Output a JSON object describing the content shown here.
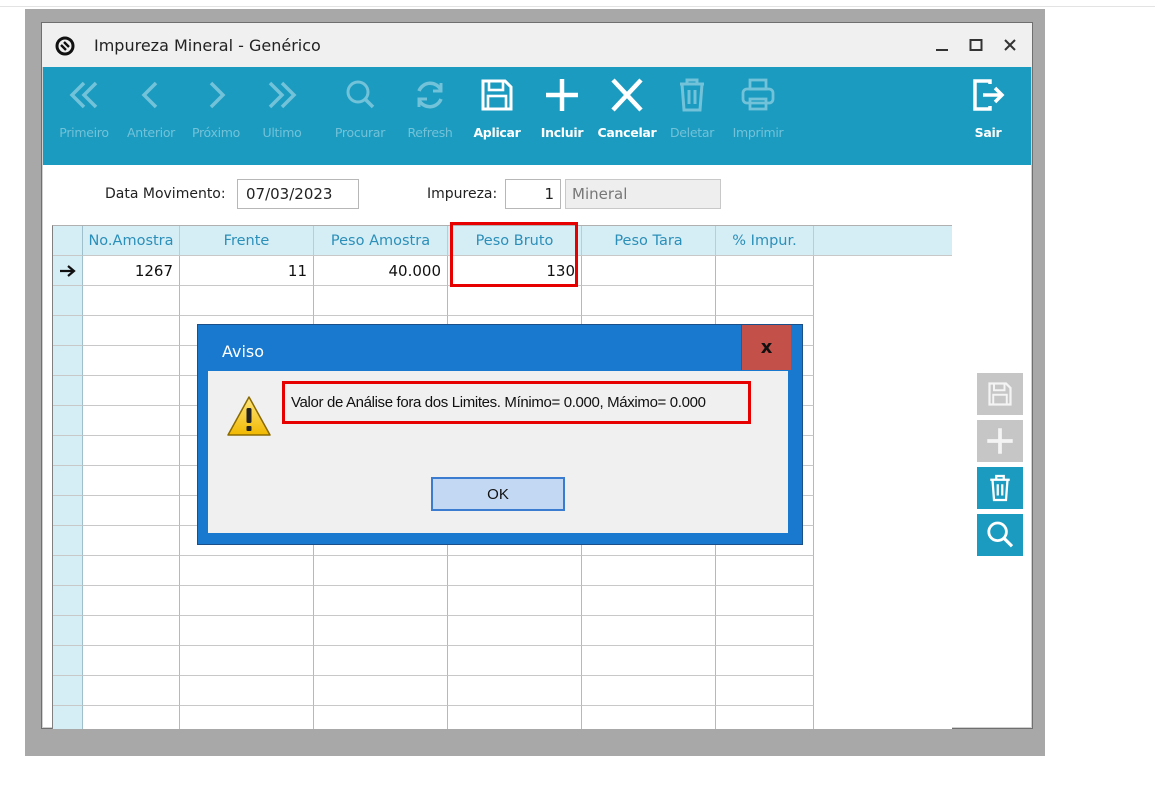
{
  "window": {
    "title": "Impureza Mineral - Genérico"
  },
  "toolbar": {
    "primeiro": "Primeiro",
    "anterior": "Anterior",
    "proximo": "Próximo",
    "ultimo": "Ultimo",
    "procurar": "Procurar",
    "refresh": "Refresh",
    "aplicar": "Aplicar",
    "incluir": "Incluir",
    "cancelar": "Cancelar",
    "deletar": "Deletar",
    "imprimir": "Imprimir",
    "sair": "Sair"
  },
  "form": {
    "data_movimento_label": "Data Movimento:",
    "data_movimento_value": "07/03/2023",
    "impureza_label": "Impureza:",
    "impureza_code": "1",
    "impureza_name": "Mineral"
  },
  "grid": {
    "columns": [
      "No.Amostra",
      "Frente",
      "Peso Amostra",
      "Peso Bruto",
      "Peso Tara",
      "% Impur."
    ],
    "rows": [
      {
        "no_amostra": "1267",
        "frente": "11",
        "peso_amostra": "40.000",
        "peso_bruto": "130",
        "peso_tara": "",
        "impur": ""
      }
    ]
  },
  "dialog": {
    "title": "Aviso",
    "close": "x",
    "message": "Valor de Análise fora dos Limites. Mínimo= 0.000, Máximo= 0.000",
    "ok": "OK"
  },
  "colors": {
    "toolbar": "#1b9bbf",
    "dialog_frame": "#1879cf",
    "highlight": "#e60000"
  }
}
